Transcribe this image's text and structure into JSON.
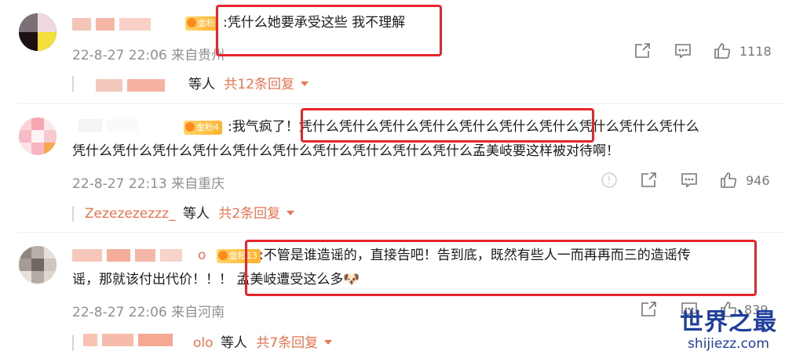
{
  "comments": [
    {
      "badge": "金粉",
      "text_lines": [
        ":凭什么她要承受这些 我不理解"
      ],
      "time": "22-8-27 22:06",
      "location": "来自贵州",
      "likes": "1118",
      "reply": {
        "suffix": "等人",
        "link": "共12条回复"
      }
    },
    {
      "badge": "金粉4",
      "text_lines": [
        ":我气疯了！凭什么凭什么凭什么凭什么凭什么凭什么凭什么凭什么凭什么凭什么",
        "凭什么凭什么凭什么凭什么凭什么凭什么凭什么凭什么凭什么凭什么孟美岐要这样被对待啊！"
      ],
      "time": "22-8-27 22:13",
      "location": "来自重庆",
      "likes": "946",
      "reply": {
        "user": "Zezezezezzz_",
        "suffix": "等人",
        "link": "共2条回复"
      }
    },
    {
      "name_tail": "o",
      "badge": "金粉13",
      "text_lines": [
        ":不管是谁造谣的，直接告吧！告到底，既然有些人一而再再而三的造谣传",
        "谣，那就该付出代价！！！ 孟美岐遭受这么多🐶"
      ],
      "time": "22-8-27 22:06",
      "location": "来自河南",
      "likes": "839",
      "reply": {
        "user": "olo",
        "suffix": "等人",
        "link": "共7条回复"
      }
    }
  ],
  "icons": {
    "share": "share-icon",
    "comment": "comment-icon",
    "like": "like-icon",
    "report": "report-icon"
  },
  "watermark": {
    "title": "世界之最",
    "url": "shijiezz.com"
  },
  "colors": {
    "highlight": "#e8252a",
    "reply_link": "#eb7350",
    "watermark": "#1f3f9e"
  }
}
